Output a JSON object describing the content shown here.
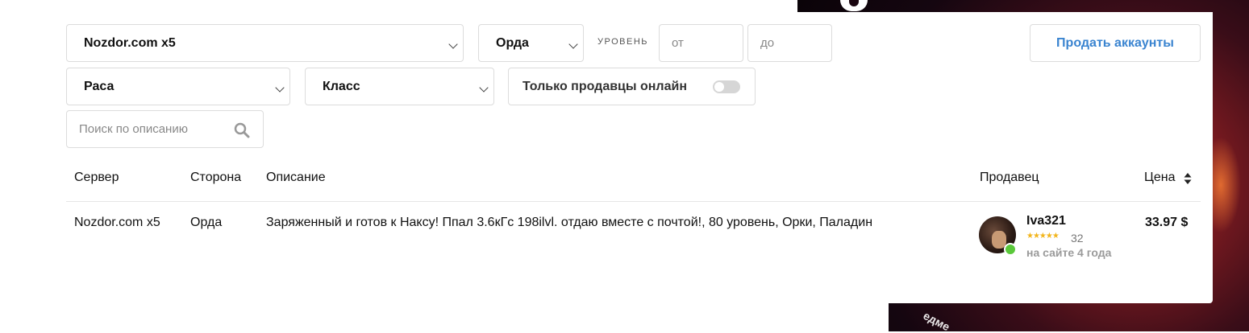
{
  "filters": {
    "server": "Nozdor.com x5",
    "faction": "Орда",
    "level_label": "УРОВЕНЬ",
    "level_from_placeholder": "от",
    "level_to_placeholder": "до",
    "race": "Раса",
    "class": "Класс",
    "online_only_label": "Только продавцы онлайн",
    "online_only_checked": false,
    "search_placeholder": "Поиск по описанию"
  },
  "sell_button": "Продать аккаунты",
  "table": {
    "headers": {
      "server": "Сервер",
      "side": "Сторона",
      "description": "Описание",
      "seller": "Продавец",
      "price": "Цена"
    },
    "rows": [
      {
        "server": "Nozdor.com x5",
        "side": "Орда",
        "description": "Заряженный и готов к Наксу! Ппал 3.6кГс 198ilvl. отдаю вместе с почтой!, 80 уровень, Орки, Паладин",
        "seller_name": "Iva321",
        "rating_stars": "★★★★★",
        "rating_count": "32",
        "seller_since": "на сайте 4 года",
        "seller_online": true,
        "price": "33.97 $"
      }
    ]
  },
  "banner_text": "едме",
  "colors": {
    "accent": "#3a84d0",
    "online": "#5ac83a",
    "star": "#f2b51c"
  }
}
